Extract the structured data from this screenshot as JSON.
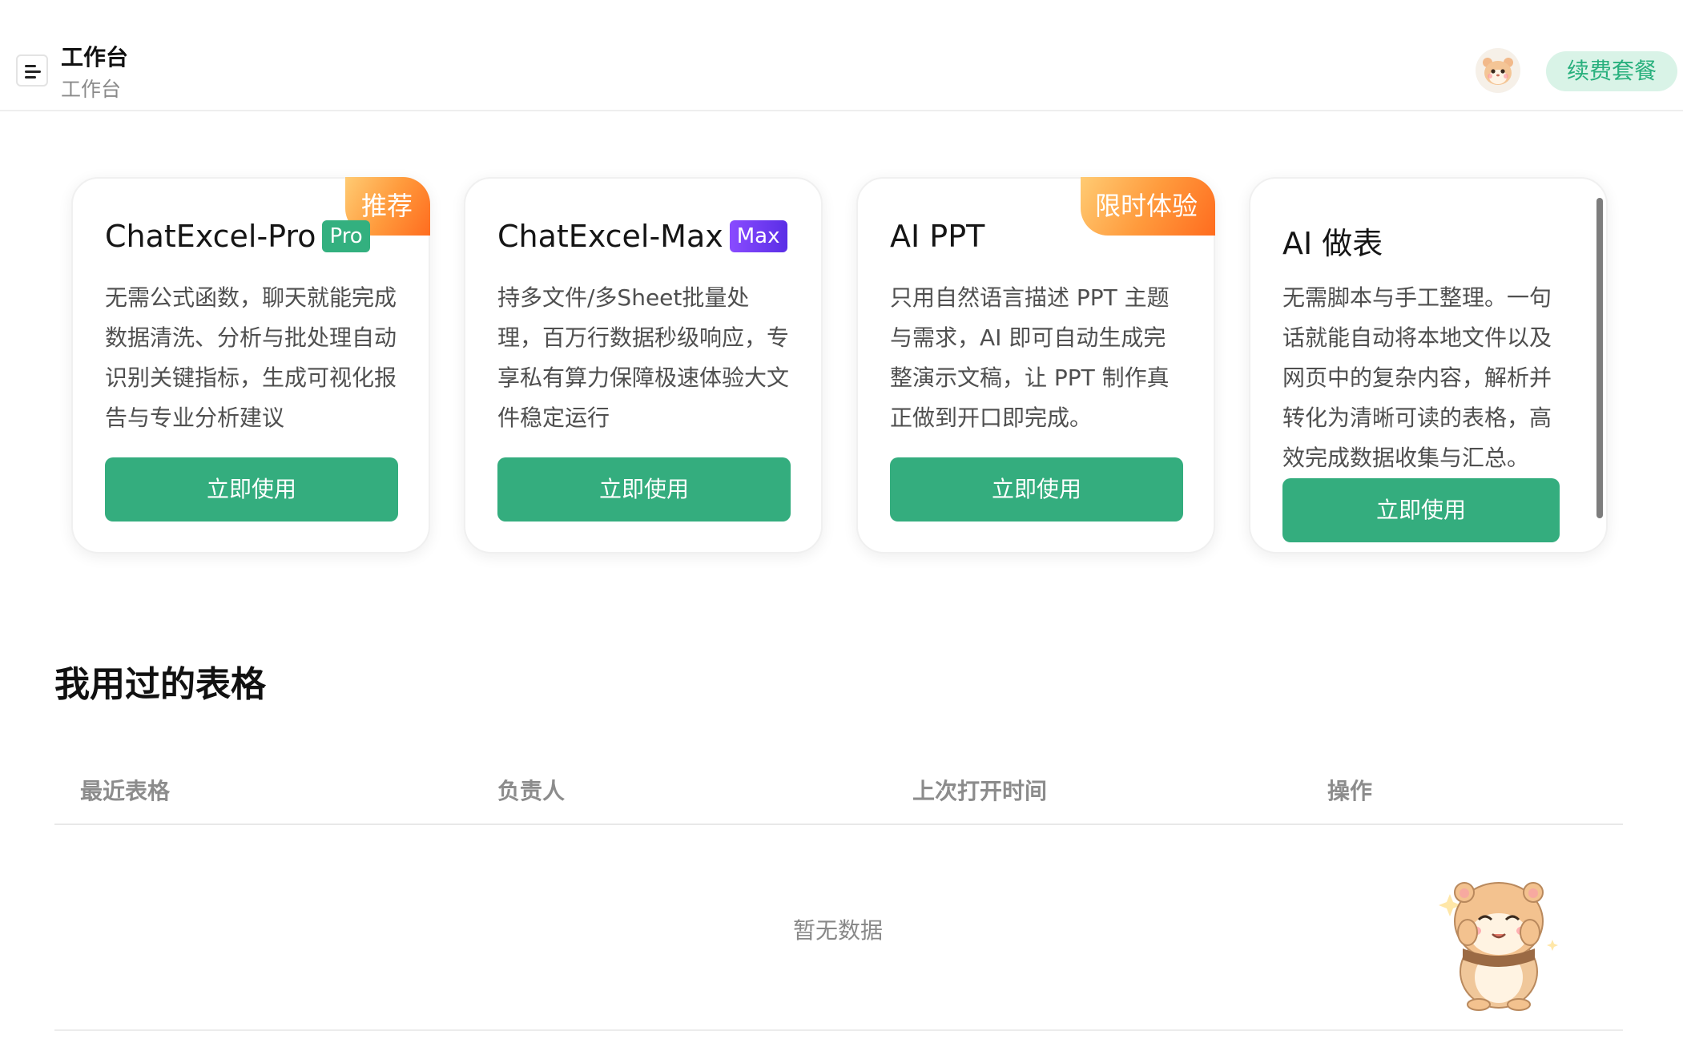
{
  "header": {
    "title": "工作台",
    "subtitle": "工作台",
    "renew_label": "续费套餐"
  },
  "cards": [
    {
      "title": "ChatExcel-Pro",
      "tag": "Pro",
      "ribbon": "推荐",
      "desc": "无需公式函数，聊天就能完成数据清洗、分析与批处理自动识别关键指标，生成可视化报告与专业分析建议",
      "button": "立即使用"
    },
    {
      "title": "ChatExcel-Max",
      "tag": "Max",
      "desc": "持多文件/多Sheet批量处理，百万行数据秒级响应，专享私有算力保障极速体验大文件稳定运行",
      "button": "立即使用"
    },
    {
      "title": "AI PPT",
      "ribbon": "限时体验",
      "desc": "只用自然语言描述 PPT 主题与需求，AI 即可自动生成完整演示文稿，让 PPT 制作真正做到开口即完成。",
      "button": "立即使用"
    },
    {
      "title": "AI 做表",
      "desc": "无需脚本与手工整理。一句话就能自动将本地文件以及网页中的复杂内容，解析并转化为清晰可读的表格，高效完成数据收集与汇总。",
      "button": "立即使用"
    }
  ],
  "section": {
    "title": "我用过的表格",
    "columns": [
      "最近表格",
      "负责人",
      "上次打开时间",
      "操作"
    ],
    "empty_text": "暂无数据"
  },
  "colors": {
    "primary": "#34ad7e",
    "ribbon": "#ff8a2b",
    "renew_bg": "#d9f3e7"
  }
}
